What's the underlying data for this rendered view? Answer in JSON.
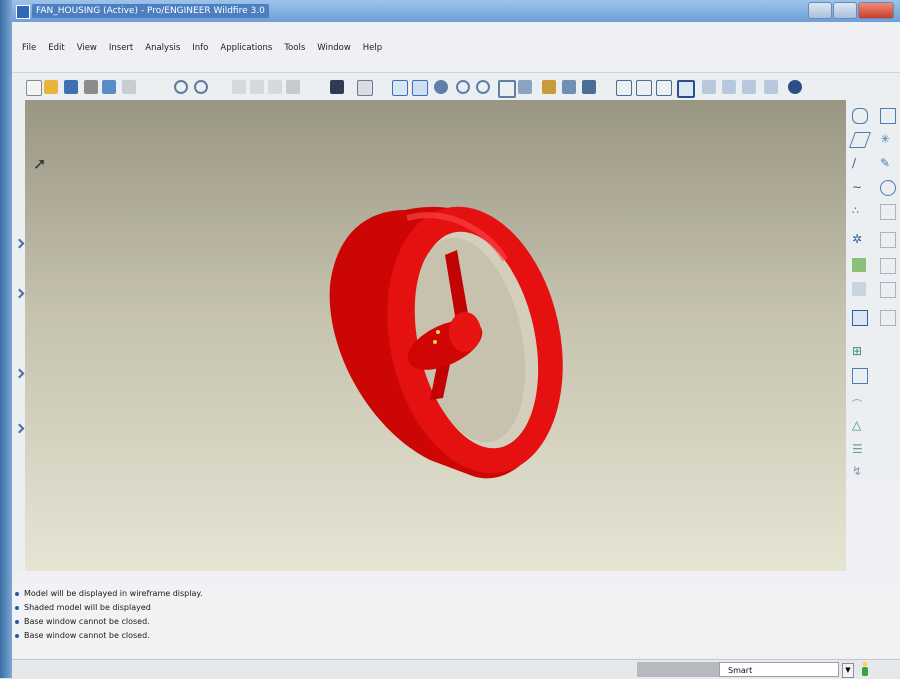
{
  "window": {
    "title": "FAN_HOUSING (Active) - Pro/ENGINEER Wildfire 3.0"
  },
  "menubar": {
    "items": [
      "File",
      "Edit",
      "View",
      "Insert",
      "Analysis",
      "Info",
      "Applications",
      "Tools",
      "Window",
      "Help"
    ]
  },
  "toolbar": {
    "icons": [
      "new-file-icon",
      "open-file-icon",
      "save-icon",
      "print-icon",
      "email-icon",
      "copy-icon",
      "undo-icon",
      "redo-icon",
      "cut-icon",
      "copy-icon",
      "paste-icon",
      "paste-special-icon",
      "regenerate-icon",
      "find-icon",
      "select-filter-icon",
      "repaint-icon",
      "spin-center-icon",
      "orient-icon",
      "zoom-in-icon",
      "zoom-out-icon",
      "refit-icon",
      "reorient-icon",
      "saved-views-icon",
      "layers-icon",
      "view-manager-icon",
      "wireframe-icon",
      "hidden-line-icon",
      "no-hidden-icon",
      "shading-icon",
      "datum-planes-icon",
      "datum-axes-icon",
      "datum-points-icon",
      "coordinate-systems-icon",
      "help-icon"
    ]
  },
  "viewport": {
    "model": "fan-housing",
    "model_color": "#e10c0c",
    "background_top": "#9a9684",
    "background_bottom": "#e6e4d3"
  },
  "messages": [
    "Model will be displayed in wireframe display.",
    "Shaded model will be displayed",
    "Base window cannot be closed.",
    "Base window cannot be closed."
  ],
  "status": {
    "filter_value": "Smart"
  }
}
